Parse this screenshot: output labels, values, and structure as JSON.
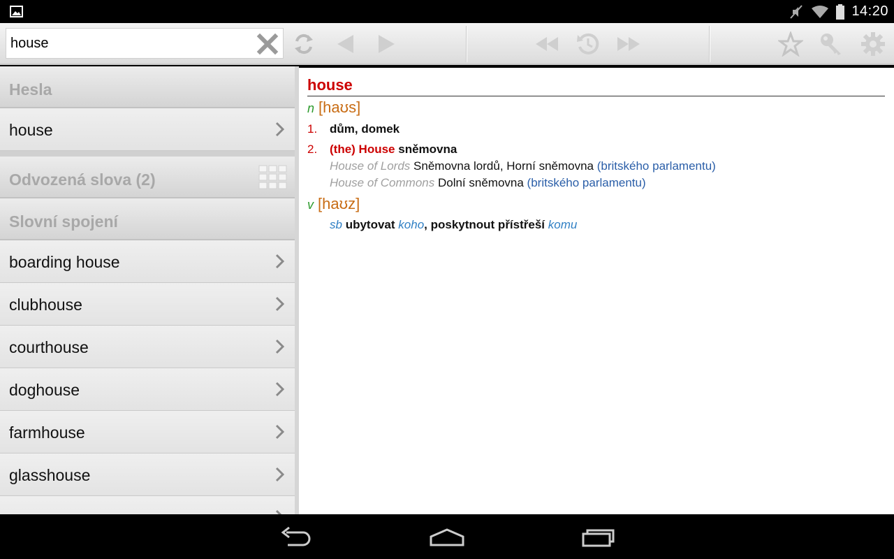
{
  "status_bar": {
    "time": "14:20",
    "icons": [
      "gallery-icon",
      "mute-icon",
      "wifi-icon",
      "battery-icon"
    ]
  },
  "toolbar": {
    "search": {
      "value": "house",
      "placeholder": ""
    },
    "icons": [
      "clear-icon",
      "swap-icon",
      "back-icon",
      "forward-icon",
      "first-icon",
      "history-icon",
      "last-icon",
      "star-icon",
      "key-icon",
      "gear-icon"
    ]
  },
  "left_panel": {
    "headwords_header": "Hesla",
    "headwords": [
      {
        "label": "house"
      }
    ],
    "derived_header": "Odvozená slova (2)",
    "phrases_header": "Slovní spojení",
    "phrases": [
      {
        "label": "boarding house"
      },
      {
        "label": "clubhouse"
      },
      {
        "label": "courthouse"
      },
      {
        "label": "doghouse"
      },
      {
        "label": "farmhouse"
      },
      {
        "label": "glasshouse"
      }
    ]
  },
  "entry": {
    "headword": "house",
    "noun": {
      "pos": "n",
      "pron": "[haʊs]"
    },
    "sense1": {
      "num": "1.",
      "text": "dům, domek"
    },
    "sense2": {
      "num": "2.",
      "red": "(the) House",
      "text": "sněmovna"
    },
    "ex1": {
      "phrase": "House of Lords",
      "trans": "Sněmovna lordů, Horní sněmovna",
      "note": "(britského parlamentu)"
    },
    "ex2": {
      "phrase": "House of Commons",
      "trans": "Dolní sněmovna",
      "note": "(britského parlamentu)"
    },
    "verb": {
      "pos": "v",
      "pron": "[haʊz]"
    },
    "verb_sense": {
      "sb": "sb",
      "w1": "ubytovat",
      "koho": "koho",
      "w2": ", poskytnout přístřeší",
      "komu": "komu"
    }
  },
  "colors": {
    "headword": "#cc0000",
    "pos": "#2e9b2e",
    "pronunciation": "#c86c14",
    "note": "#2a5ea8"
  }
}
